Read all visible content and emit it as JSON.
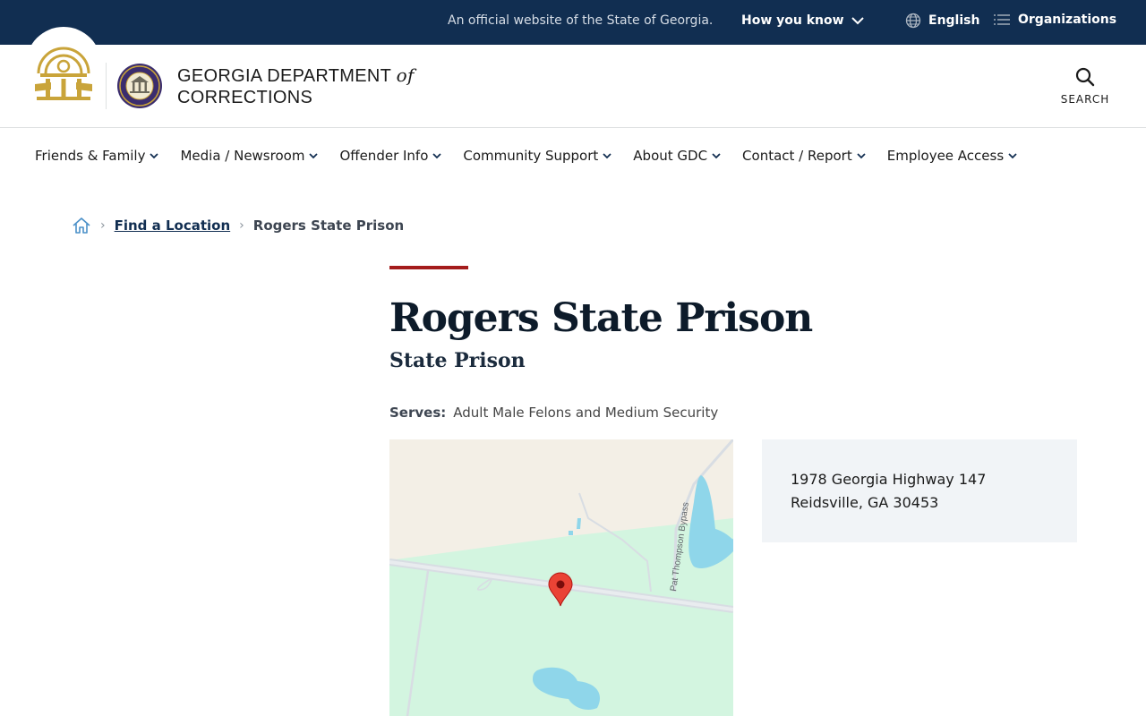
{
  "banner": {
    "official_text": "An official website of the State of Georgia.",
    "how_you_know": "How you know",
    "language": "English",
    "organizations": "Organizations"
  },
  "header": {
    "agency_line1": "GEORGIA DEPARTMENT",
    "agency_of": "of",
    "agency_line2": "CORRECTIONS",
    "search_label": "SEARCH"
  },
  "nav": {
    "items": [
      {
        "label": "Friends & Family"
      },
      {
        "label": "Media / Newsroom"
      },
      {
        "label": "Offender Info"
      },
      {
        "label": "Community Support"
      },
      {
        "label": "About GDC"
      },
      {
        "label": "Contact / Report"
      },
      {
        "label": "Employee Access"
      }
    ]
  },
  "breadcrumb": {
    "link": "Find a Location",
    "current": "Rogers State Prison"
  },
  "facility": {
    "title": "Rogers State Prison",
    "subtitle": "State Prison",
    "serves_label": "Serves:",
    "serves_value": "Adult Male Felons and Medium Security",
    "address_line1": "1978 Georgia Highway 147",
    "address_line2": "Reidsville, GA 30453"
  },
  "map": {
    "road_label": "Pat Thompson Bypass"
  },
  "colors": {
    "banner_bg": "#112e51",
    "accent_red": "#a41c1c",
    "address_bg": "#f1f4f7"
  }
}
